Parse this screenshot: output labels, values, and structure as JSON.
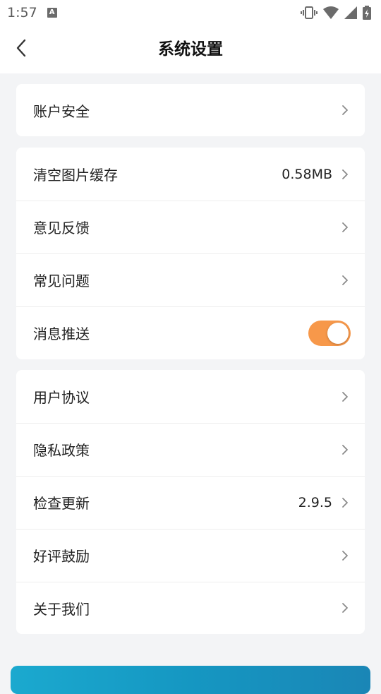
{
  "status": {
    "time": "1:57",
    "app_icon_letter": "A"
  },
  "header": {
    "title": "系统设置"
  },
  "groups": [
    {
      "items": [
        {
          "label": "账户安全"
        }
      ]
    },
    {
      "items": [
        {
          "label": "清空图片缓存",
          "value": "0.58MB"
        },
        {
          "label": "意见反馈"
        },
        {
          "label": "常见问题"
        },
        {
          "label": "消息推送",
          "toggle": true
        }
      ]
    },
    {
      "items": [
        {
          "label": "用户协议"
        },
        {
          "label": "隐私政策"
        },
        {
          "label": "检查更新",
          "value": "2.9.5"
        },
        {
          "label": "好评鼓励"
        },
        {
          "label": "关于我们"
        }
      ]
    }
  ],
  "colors": {
    "toggle_on": "#f7984a",
    "bottom_button": "#1597c2",
    "background": "#f3f4f6"
  }
}
